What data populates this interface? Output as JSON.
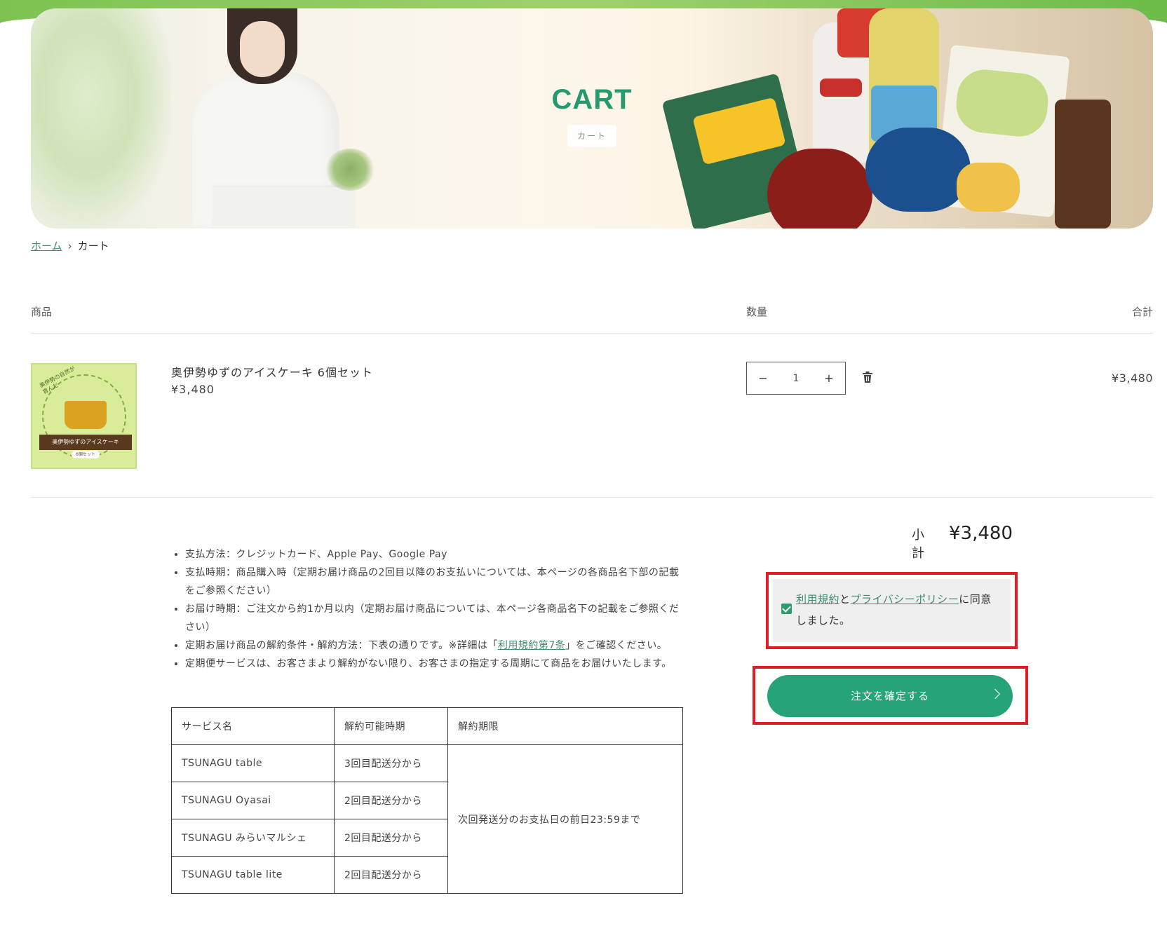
{
  "hero": {
    "title": "CART",
    "subtitle": "カート"
  },
  "breadcrumb": {
    "home": "ホーム",
    "separator": "›",
    "current": "カート"
  },
  "table_header": {
    "item": "商品",
    "quantity": "数量",
    "total": "合計"
  },
  "cart_items": [
    {
      "name": "奥伊勢ゆずのアイスケーキ 6個セット",
      "price": "¥3,480",
      "quantity": "1",
      "line_total": "¥3,480",
      "thumb": {
        "corner_text": "奥伊勢の自然が育んだ",
        "banner": "奥伊勢ゆずのアイスケーキ",
        "badge": "6個セット"
      }
    }
  ],
  "qty_controls": {
    "minus": "−",
    "plus": "+"
  },
  "notes": {
    "payment_method": "支払方法：クレジットカード、Apple Pay、Google Pay",
    "payment_timing": "支払時期：商品購入時（定期お届け商品の2回目以降のお支払いについては、本ページの各商品名下部の記載をご参照ください）",
    "delivery_timing": "お届け時期：ご注文から約1か月以内（定期お届け商品については、本ページ各商品名下の記載をご参照ください）",
    "cancel_prefix": "定期お届け商品の解約条件・解約方法：下表の通りです。※詳細は「",
    "cancel_link": "利用規約第7条",
    "cancel_suffix": "」をご確認ください。",
    "subscription": "定期便サービスは、お客さまより解約がない限り、お客さまの指定する周期にて商品をお届けいたします。"
  },
  "service_table": {
    "headers": [
      "サービス名",
      "解約可能時期",
      "解約期限"
    ],
    "rows": [
      {
        "name": "TSUNAGU table",
        "period": "3回目配送分から"
      },
      {
        "name": "TSUNAGU Oyasai",
        "period": "2回目配送分から"
      },
      {
        "name": "TSUNAGU みらいマルシェ",
        "period": "2回目配送分から"
      },
      {
        "name": "TSUNAGU table lite",
        "period": "2回目配送分から"
      }
    ],
    "deadline": "次回発送分のお支払日の前日23:59まで"
  },
  "summary": {
    "subtotal_label": "小計",
    "subtotal_value": "¥3,480",
    "agree_terms_link": "利用規約",
    "agree_and": "と",
    "agree_privacy_link": "プライバシーポリシー",
    "agree_suffix": "に同意しました。",
    "agree_checked": true,
    "confirm_label": "注文を確定する"
  },
  "colors": {
    "accent": "#27a37a",
    "link": "#3d8d72",
    "highlight": "#e31b23",
    "hero_title": "#259a6f"
  },
  "icons": {
    "trash": "trash-icon",
    "chevron": "chevron-right-icon",
    "breadcrumb_sep": "chevron-right-icon"
  }
}
